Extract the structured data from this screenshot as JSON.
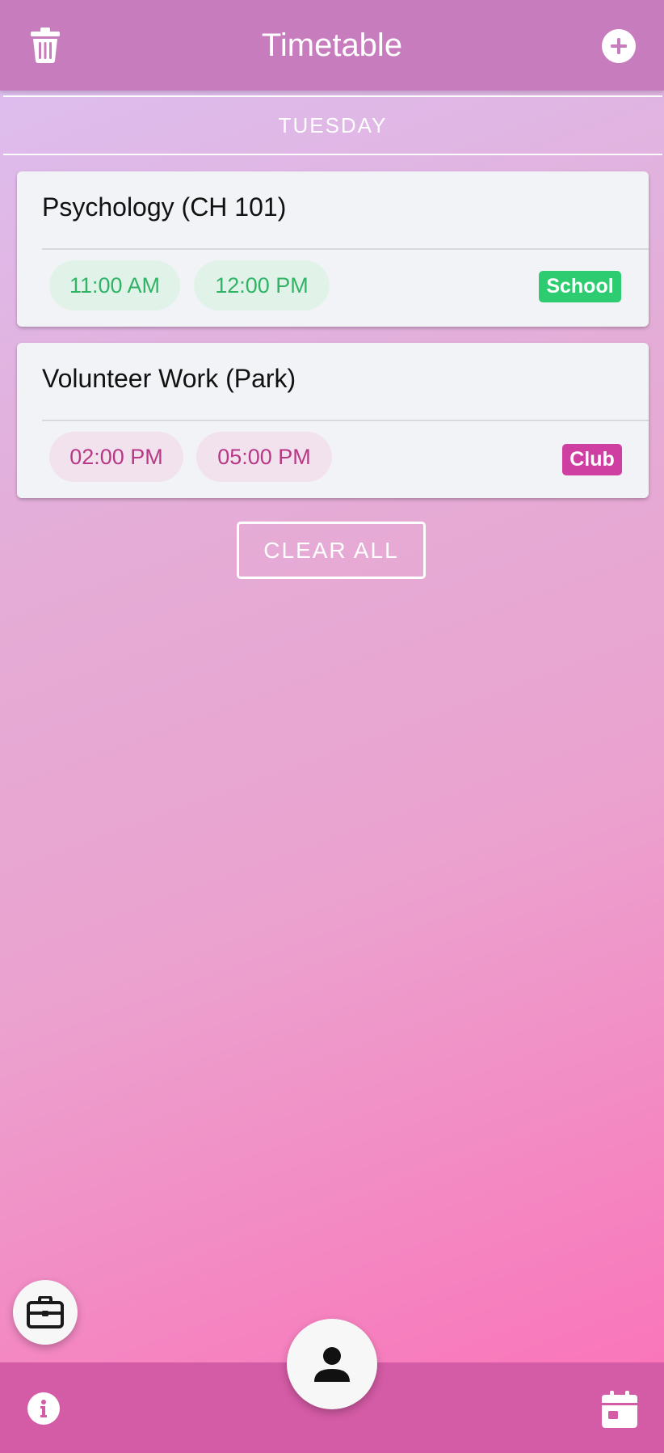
{
  "header": {
    "title": "Timetable"
  },
  "day": {
    "label": "TUESDAY"
  },
  "entries": [
    {
      "title": "Psychology (CH 101)",
      "start": "11:00 AM",
      "end": "12:00 PM",
      "category": "School"
    },
    {
      "title": "Volunteer Work (Park)",
      "start": "02:00 PM",
      "end": "05:00 PM",
      "category": "Club"
    }
  ],
  "actions": {
    "clear_all": "CLEAR ALL"
  },
  "icons": {
    "top_left": "trash-icon",
    "top_right": "plus-circle-icon",
    "bottom_left": "info-icon",
    "bottom_right": "calendar-icon",
    "fab_left": "briefcase-icon",
    "fab_center": "person-icon"
  },
  "colors": {
    "header": "#c77dbd",
    "bottom_bar": "#d45ba5",
    "school": "#2ecc71",
    "club": "#cf3fa2"
  }
}
